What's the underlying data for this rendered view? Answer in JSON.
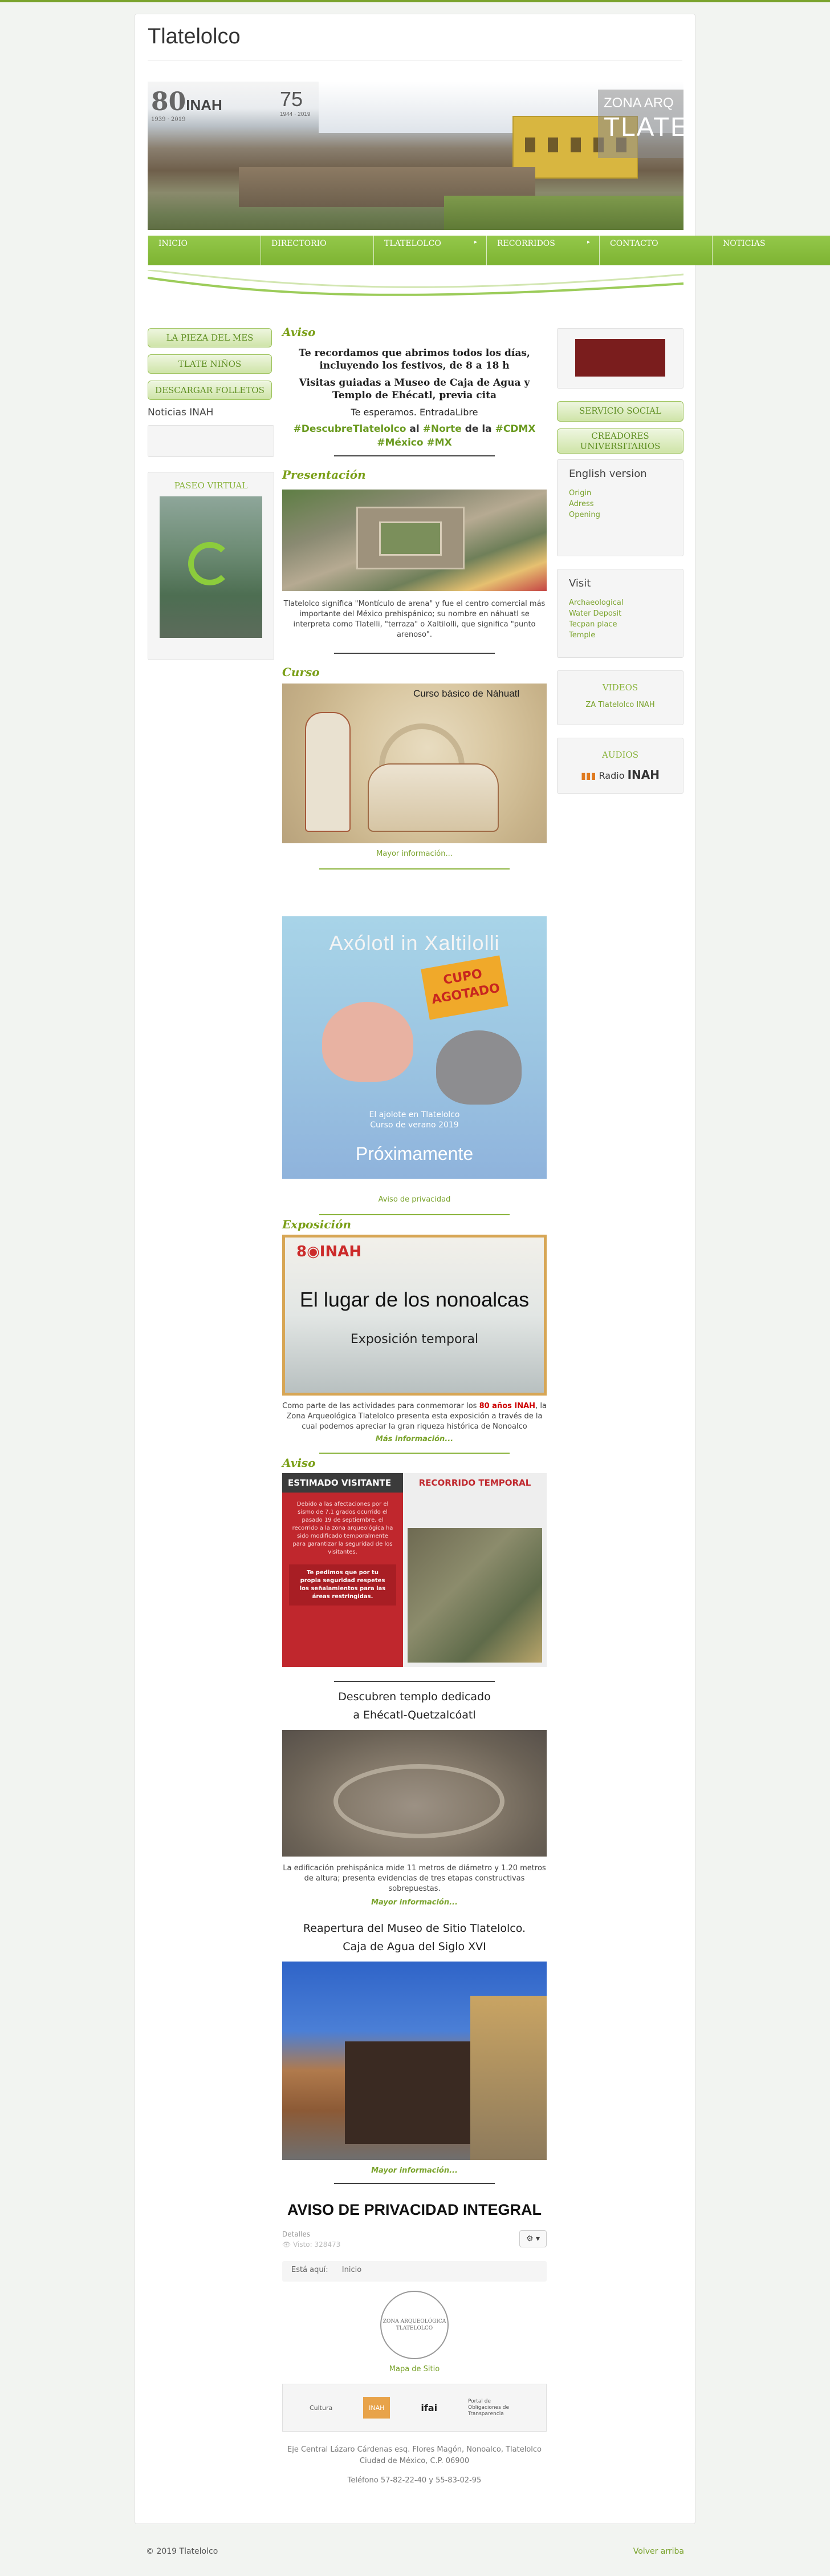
{
  "site": {
    "title": "Tlatelolco"
  },
  "banner": {
    "logo_80": "80",
    "logo_inah": "INAH",
    "logo_80_years": "1939 · 2019",
    "logo_75": "75",
    "logo_75_years": "1944 · 2019",
    "zona_line1": "ZONA ARQ",
    "zona_line2": "TLATE"
  },
  "menu": {
    "items": [
      {
        "label": "INICIO",
        "arrow": ""
      },
      {
        "label": "DIRECTORIO",
        "arrow": ""
      },
      {
        "label": "TLATELOLCO",
        "arrow": "▸"
      },
      {
        "label": "RECORRIDOS",
        "arrow": "▸"
      },
      {
        "label": "CONTACTO",
        "arrow": ""
      },
      {
        "label": "NOTICIAS",
        "arrow": ""
      }
    ]
  },
  "left_sidebar": {
    "buttons": [
      "LA PIEZA DEL MES",
      "TLATE NIÑOS",
      "DESCARGAR FOLLETOS"
    ],
    "noticias_label": "Noticias INAH",
    "paseo_title": "PASEO VIRTUAL"
  },
  "right_sidebar": {
    "buttons": [
      "SERVICIO SOCIAL",
      "CREADORES UNIVERSITARIOS"
    ],
    "english_heading": "English version",
    "english_links": [
      "Origin",
      "Adress",
      "Opening"
    ],
    "visit_heading": "Visit",
    "visit_links": [
      "Archaeological",
      "Water Deposit",
      "Tecpan place",
      "Temple"
    ],
    "videos_title": "VIDEOS",
    "videos_link": "ZA Tlatelolco INAH",
    "audios_title": "AUDIOS",
    "radio_label": "Radio",
    "radio_inah": "INAH"
  },
  "aviso1": {
    "heading": "Aviso",
    "line1": "Te recordamos que abrimos todos los días, incluyendo los festivos, de 8 a 18 h",
    "line2": "Visitas guiadas a Museo de Caja de Agua y Templo de Ehécatl, previa cita",
    "line3": "Te esperamos. EntradaLibre",
    "hashtags_a": "#DescubreTlatelolco",
    "hashtags_al": " al ",
    "hashtags_b": "#Norte",
    "hashtags_de": " de la ",
    "hashtags_c": "#CDMX #México #MX"
  },
  "presentacion": {
    "heading": "Presentación",
    "text": "Tlatelolco significa \"Montículo de arena\" y fue el centro comercial más importante del México prehispánico; su nombre en náhuatl se interpreta como Tlatelli, \"terraza\" o Xaltilolli, que significa \"punto arenoso\"."
  },
  "curso": {
    "heading": "Curso",
    "image_title": "Curso básico de Náhuatl",
    "more": "Mayor información..."
  },
  "axolotl": {
    "title": "Axólotl in Xaltilolli",
    "cupo": "CUPO AGOTADO",
    "subtitle": "El ajolote en Tlatelolco",
    "subtitle2": "Curso de verano 2019",
    "proximamente": "Próximamente",
    "privacy_link": "Aviso de privacidad"
  },
  "exposicion": {
    "heading": "Exposición",
    "image_title": "El lugar de los nonoalcas",
    "image_sub": "Exposición temporal",
    "text_a": "Como parte de las actividades para conmemorar los ",
    "text_highlight": "80 años INAH",
    "text_b": ", la Zona Arqueológica Tlatelolco presenta esta exposición a través de la cual podemos apreciar la gran riqueza histórica de Nonoalco",
    "more": "Más información..."
  },
  "aviso2": {
    "heading": "Aviso",
    "estimado": "ESTIMADO VISITANTE",
    "estimado_text": "Debido a las afectaciones por el sismo de 7.1 grados ocurrido el pasado 19 de septiembre, el recorrido a la zona arqueológica ha sido modificado temporalmente para garantizar la seguridad de los visitantes.",
    "estimado_warn": "Te pedimos que por tu propia seguridad respetes los señalamientos para las áreas restringidas.",
    "recorrido": "RECORRIDO TEMPORAL"
  },
  "templo": {
    "title_line1": "Descubren templo dedicado",
    "title_line2": "a Ehécatl-Quetzalcóatl",
    "text": "La edificación prehispánica mide 11 metros de diámetro y 1.20 metros de altura; presenta evidencias de tres etapas constructivas sobrepuestas.",
    "more": "Mayor información..."
  },
  "reapertura": {
    "title_line1": "Reapertura del Museo de Sitio Tlatelolco.",
    "title_line2": "Caja de Agua del Siglo XVI",
    "more": "Mayor información..."
  },
  "privacidad": {
    "title": "AVISO DE PRIVACIDAD INTEGRAL",
    "details_label": "Detalles",
    "visits": "Visto: 328473",
    "gear": "⚙ ▾"
  },
  "breadcrumb": {
    "prefix": "Está aquí:",
    "current": "Inicio"
  },
  "site_map": {
    "seal_text": "ZONA ARQUEOLÓGICA TLATELOLCO",
    "link": "Mapa de Sitio"
  },
  "footer_logos": [
    "Cultura",
    "INAH",
    "ifai",
    "Portal de Obligaciones de Transparencia"
  ],
  "address": {
    "line1": "Eje Central Lázaro Cárdenas esq. Flores Magón, Nonoalco, Tlatelolco",
    "line2": "Ciudad de México, C.P. 06900",
    "line3": "Teléfono 57-82-22-40 y 55-83-02-95"
  },
  "bottom": {
    "copyright": "© 2019 Tlatelolco",
    "back_top": "Volver arriba"
  },
  "colors": {
    "brand_green": "#7aa32c",
    "menu_green": "#8cc13f",
    "heading_green": "#7a9f17",
    "highlight_red": "#cc0000"
  }
}
